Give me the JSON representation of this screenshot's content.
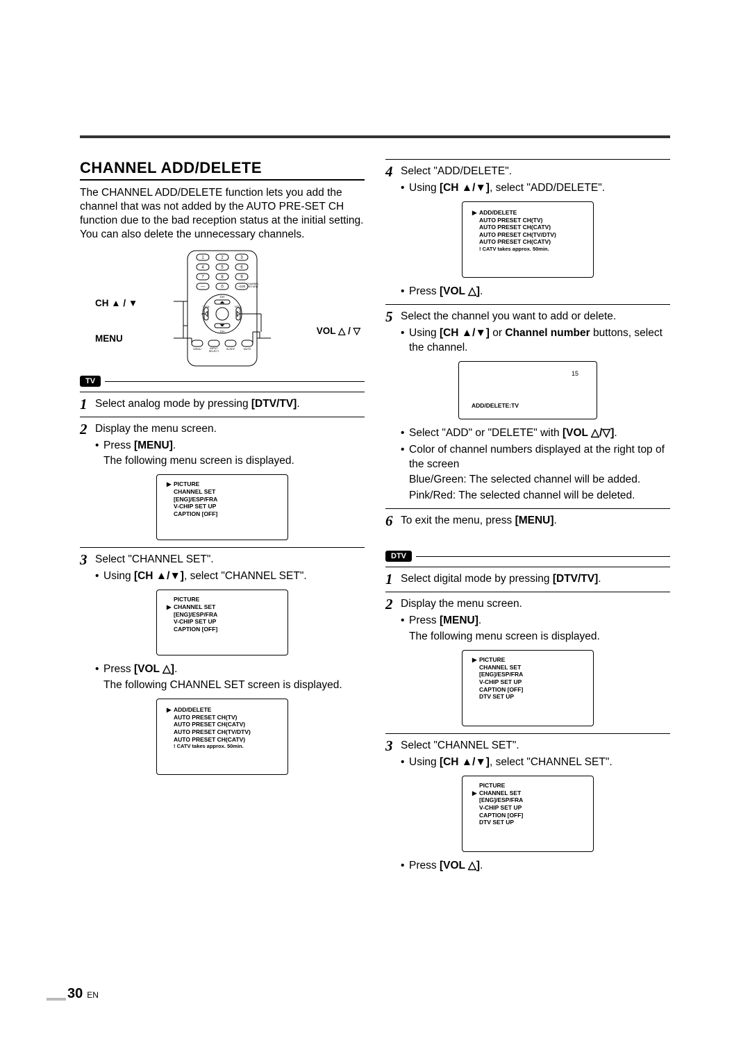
{
  "page": {
    "number": "30",
    "lang": "EN",
    "title": "CHANNEL ADD/DELETE",
    "intro": "The CHANNEL ADD/DELETE function lets you add the channel that was not added by the AUTO PRE-SET CH function due to the bad reception status at the initial setting. You can also delete the unnecessary channels."
  },
  "remote": {
    "label_ch": "CH ▲ / ▼",
    "label_menu": "MENU",
    "label_vol": "VOL △ / ▽",
    "keys": {
      "digits": [
        "1",
        "2",
        "3",
        "4",
        "5",
        "6",
        "7",
        "8",
        "9",
        "0"
      ],
      "dash": "—",
      "plus100": "+100",
      "channel_return": "CHANNEL\nRETURN",
      "ch": "CH",
      "vol_left": "VOL",
      "vol_right": "VOL",
      "menu": "MENU",
      "input_select": "INPUT\nSELECT",
      "sleep": "SLEEP",
      "mute": "MUTE"
    }
  },
  "badges": {
    "tv": "TV",
    "dtv": "DTV"
  },
  "tv": {
    "step1": "Select analog mode by pressing ",
    "step1_key": "[DTV/TV]",
    "step2": "Display the menu screen.",
    "step2_sub1_prefix": "Press ",
    "step2_sub1_key": "[MENU]",
    "step2_sub1_after": "The following menu screen is displayed.",
    "osd_menu": {
      "items": [
        "PICTURE",
        "CHANNEL SET",
        "[ENG]/ESP/FRA",
        "V-CHIP SET UP",
        "CAPTION [OFF]"
      ],
      "selected_index": 0
    },
    "step3": "Select \"CHANNEL SET\".",
    "step3_sub1_prefix": "Using ",
    "step3_sub1_key": "[CH ▲/▼]",
    "step3_sub1_suffix": ", select \"CHANNEL SET\".",
    "osd_menu_ch": {
      "items": [
        "PICTURE",
        "CHANNEL SET",
        "[ENG]/ESP/FRA",
        "V-CHIP SET UP",
        "CAPTION [OFF]"
      ],
      "selected_index": 1
    },
    "step3_sub2_prefix": "Press ",
    "step3_sub2_key": "[VOL △]",
    "step3_sub2_after": "The following CHANNEL SET screen is displayed.",
    "osd_channelset": {
      "items": [
        "ADD/DELETE",
        "AUTO PRESET CH(TV)",
        "AUTO PRESET CH(CATV)",
        "AUTO PRESET CH(TV/DTV)",
        "AUTO PRESET CH(CATV)",
        "! CATV takes approx. 50min."
      ],
      "selected_index": 0
    },
    "step4": "Select \"ADD/DELETE\".",
    "step4_sub1_prefix": "Using ",
    "step4_sub1_key": "[CH ▲/▼]",
    "step4_sub1_suffix": ", select \"ADD/DELETE\".",
    "osd_channelset2": {
      "items": [
        "ADD/DELETE",
        "AUTO PRESET CH(TV)",
        "AUTO PRESET CH(CATV)",
        "AUTO PRESET CH(TV/DTV)",
        "AUTO PRESET CH(CATV)",
        "! CATV takes approx. 50min."
      ],
      "selected_index": 0
    },
    "step4_sub2_prefix": "Press ",
    "step4_sub2_key": "[VOL △]",
    "step5": "Select the channel you want to add or delete.",
    "step5_sub1_prefix": "Using ",
    "step5_sub1_key1": "[CH ▲/▼]",
    "step5_sub1_mid": " or ",
    "step5_sub1_key2": "Channel number",
    "step5_sub1_suffix": " buttons, select the channel.",
    "osd_adddelete": {
      "channel": "15",
      "label": "ADD/DELETE:TV"
    },
    "step5_sub2": "Select \"ADD\" or \"DELETE\" with ",
    "step5_sub2_key": "[VOL △/▽]",
    "step5_sub3": "Color of channel numbers displayed at the right top of the screen",
    "step5_sub3a": "Blue/Green: The selected channel will be added.",
    "step5_sub3b": "Pink/Red: The selected channel will be deleted.",
    "step6_prefix": "To exit the menu, press ",
    "step6_key": "[MENU]"
  },
  "dtv": {
    "step1": "Select digital mode by pressing ",
    "step1_key": "[DTV/TV]",
    "step2": "Display the menu screen.",
    "step2_sub1_prefix": "Press ",
    "step2_sub1_key": "[MENU]",
    "step2_sub1_after": "The following menu screen is displayed.",
    "osd_menu": {
      "items": [
        "PICTURE",
        "CHANNEL SET",
        "[ENG]/ESP/FRA",
        "V-CHIP SET UP",
        "CAPTION [OFF]",
        "DTV SET UP"
      ],
      "selected_index": 0
    },
    "step3": "Select \"CHANNEL SET\".",
    "step3_sub1_prefix": "Using ",
    "step3_sub1_key": "[CH ▲/▼]",
    "step3_sub1_suffix": ", select \"CHANNEL SET\".",
    "osd_menu_ch": {
      "items": [
        "PICTURE",
        "CHANNEL SET",
        "[ENG]/ESP/FRA",
        "V-CHIP SET UP",
        "CAPTION [OFF]",
        "DTV SET UP"
      ],
      "selected_index": 1
    },
    "step3_sub2_prefix": "Press ",
    "step3_sub2_key": "[VOL △]"
  }
}
